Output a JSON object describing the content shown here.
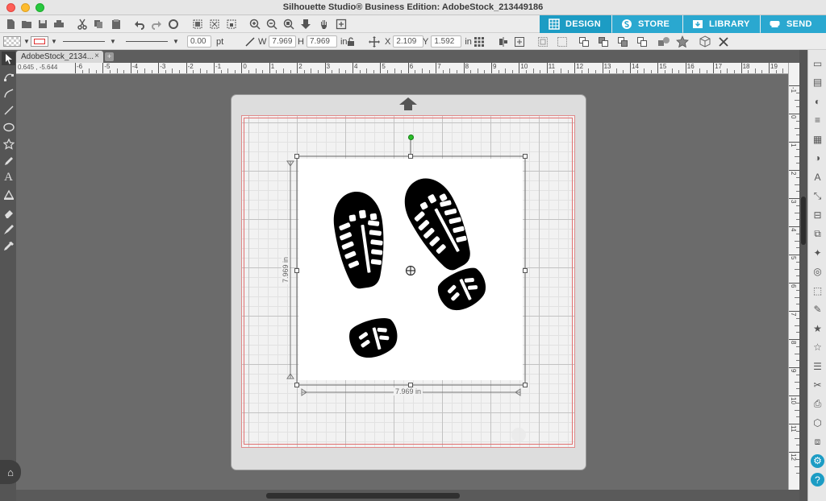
{
  "window": {
    "title": "Silhouette Studio® Business Edition: AdobeStock_213449186"
  },
  "toolbar": {
    "icons": [
      "new-icon",
      "open-icon",
      "save-icon",
      "print-icon",
      "cut-icon",
      "copy-icon",
      "paste-icon",
      "undo-icon",
      "redo-icon",
      "redraw-icon",
      "select-all-icon",
      "deselect-icon",
      "zoom-in-icon",
      "zoom-out-icon",
      "zoom-fit-icon",
      "pan-icon",
      "fit-page-icon"
    ]
  },
  "modes": [
    {
      "label": "DESIGN",
      "color": "#1c9cc4",
      "icon": "grid-icon"
    },
    {
      "label": "STORE",
      "color": "#2aa8d0",
      "icon": "silhouette-s-icon"
    },
    {
      "label": "LIBRARY",
      "color": "#2aa8d0",
      "icon": "library-icon"
    },
    {
      "label": "SEND",
      "color": "#2aa8d0",
      "icon": "send-icon"
    }
  ],
  "properties": {
    "line_width": "0.00",
    "line_unit": "pt",
    "w_label": "W",
    "width": "7.969",
    "h_label": "H",
    "height": "7.969",
    "size_unit": "in",
    "x_label": "X",
    "x": "2.109",
    "y_label": "Y",
    "y": "1.592",
    "pos_unit": "in"
  },
  "tabs": [
    {
      "label": "AdobeStock_2134...",
      "close": "×"
    }
  ],
  "add_tab": "+",
  "ruler": {
    "coords": "0.645 , -5.644",
    "top_ticks": [
      "-6",
      "-5",
      "-4",
      "-3",
      "-2",
      "-1",
      "0",
      "1",
      "2",
      "3",
      "4",
      "5",
      "6",
      "7",
      "8",
      "9",
      "10",
      "11",
      "12",
      "13",
      "14",
      "15",
      "16",
      "17",
      "18",
      "19"
    ],
    "side_ticks": [
      "-1",
      "0",
      "1",
      "2",
      "3",
      "4",
      "5",
      "6",
      "7",
      "8",
      "9",
      "10",
      "11",
      "12"
    ]
  },
  "selection": {
    "width_label": "7.969 in",
    "height_label": "7.969 in"
  },
  "colors": {
    "accent": "#1c9cc4",
    "mat": "#dddddd",
    "cut_border": "#e08a8a",
    "rotate_handle": "#2bbf2b"
  }
}
